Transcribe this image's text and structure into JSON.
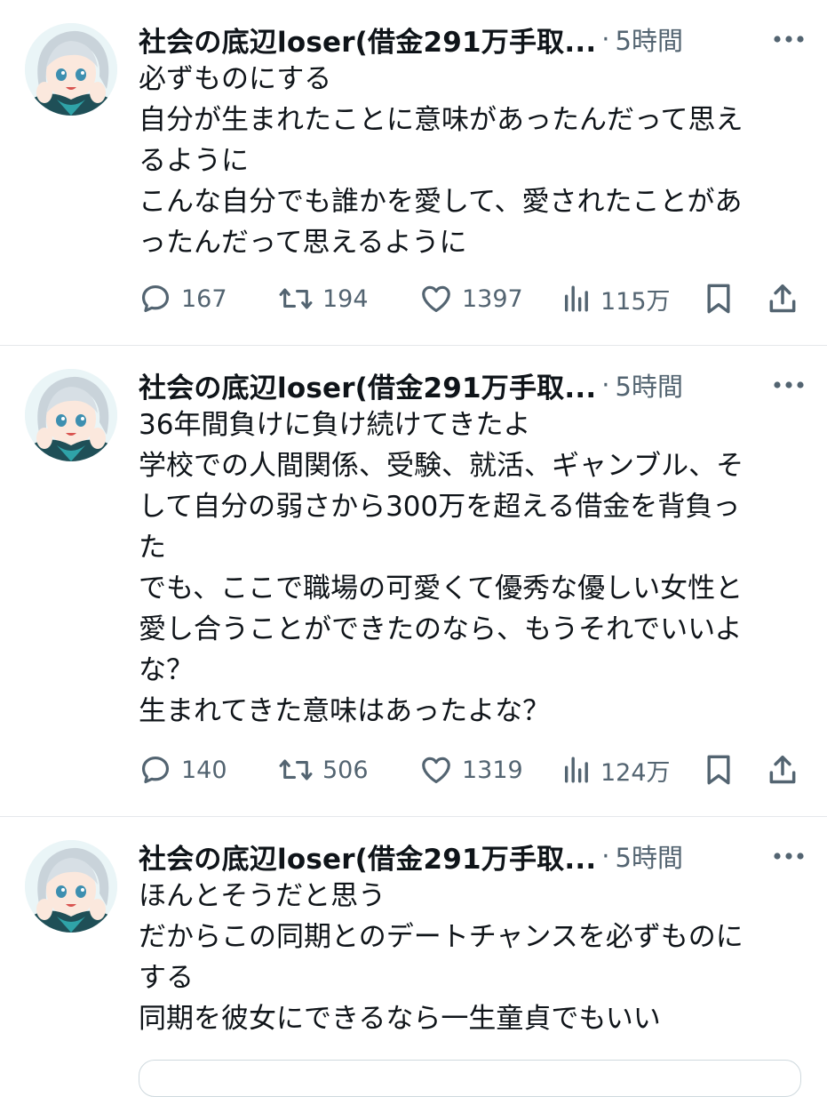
{
  "tweets": [
    {
      "author": "社会の底辺loser(借金291万手取...",
      "sep": "·",
      "time": "5時間",
      "text": "必ずものにする\n自分が生まれたことに意味があったんだって思え\nるように\nこんな自分でも誰かを愛して、愛されたことがあ\nったんだって思えるように",
      "replies": "167",
      "retweets": "194",
      "likes": "1397",
      "views": "115万"
    },
    {
      "author": "社会の底辺loser(借金291万手取...",
      "sep": "·",
      "time": "5時間",
      "text": "36年間負けに負け続けてきたよ\n学校での人間関係、受験、就活、ギャンブル、そ\nして自分の弱さから300万を超える借金を背負っ\nた\nでも、ここで職場の可愛くて優秀な優しい女性と\n愛し合うことができたのなら、もうそれでいいよ\nな？\n生まれてきた意味はあったよな？",
      "replies": "140",
      "retweets": "506",
      "likes": "1319",
      "views": "124万"
    },
    {
      "author": "社会の底辺loser(借金291万手取...",
      "sep": "·",
      "time": "5時間",
      "text": "ほんとそうだと思う\nだからこの同期とのデートチャンスを必ずものに\nする\n同期を彼女にできるなら一生童貞でもいい"
    }
  ],
  "icons": {
    "reply": "reply-icon",
    "retweet": "retweet-icon",
    "like": "like-icon",
    "views": "views-icon",
    "bookmark": "bookmark-icon",
    "share": "share-icon",
    "more": "more-icon"
  },
  "colors": {
    "text": "#0f1419",
    "secondary": "#536471",
    "divider": "#e5e8eb"
  }
}
